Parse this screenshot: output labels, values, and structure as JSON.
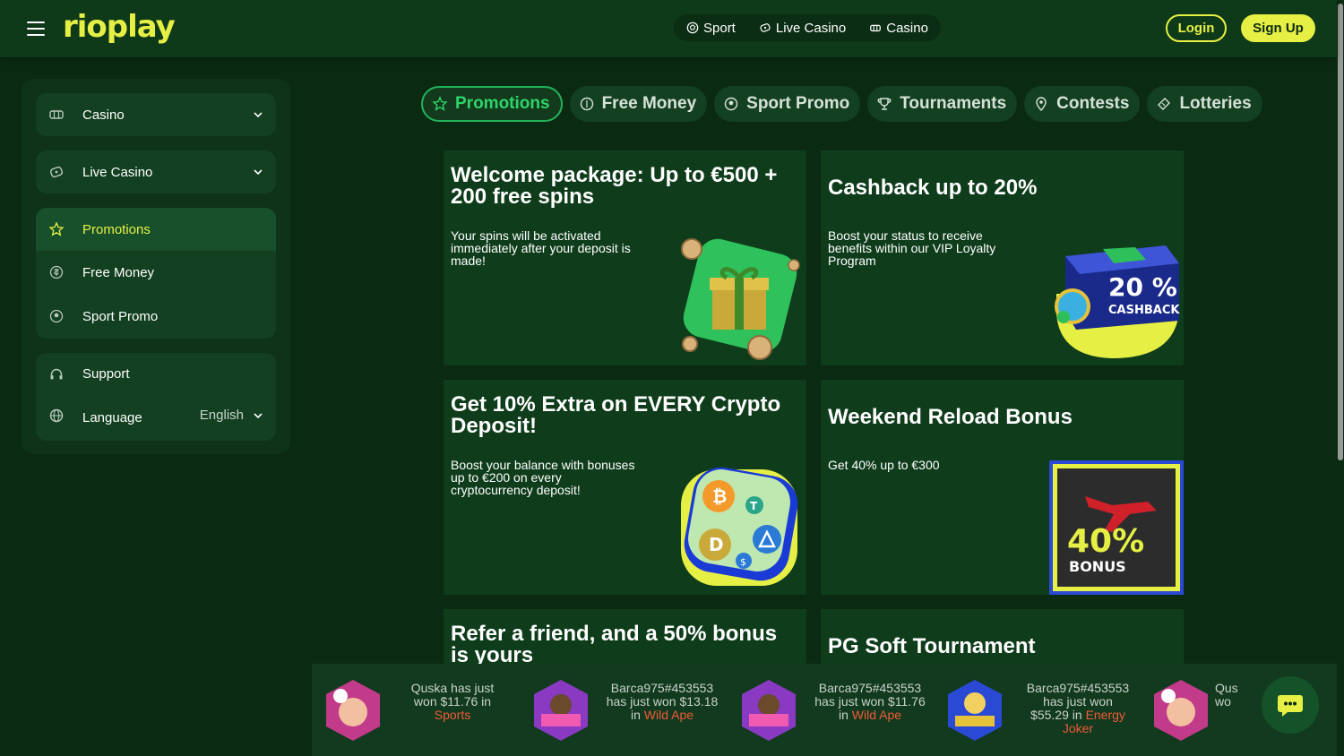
{
  "brand": {
    "logo_text": "rioplay",
    "accent": "#e6f044",
    "green": "#23b35a"
  },
  "header": {
    "nav": [
      {
        "label": "Sport",
        "icon": "football-icon"
      },
      {
        "label": "Live Casino",
        "icon": "live-casino-icon"
      },
      {
        "label": "Casino",
        "icon": "casino-icon"
      }
    ],
    "login_label": "Login",
    "signup_label": "Sign Up"
  },
  "sidebar": {
    "casino": "Casino",
    "live_casino": "Live Casino",
    "promotions": "Promotions",
    "free_money": "Free Money",
    "sport_promo": "Sport Promo",
    "support": "Support",
    "language": "Language",
    "language_value": "English"
  },
  "tabs": [
    {
      "label": "Promotions",
      "icon": "star-icon",
      "active": true
    },
    {
      "label": "Free Money",
      "icon": "money-icon",
      "active": false
    },
    {
      "label": "Sport Promo",
      "icon": "sport-promo-icon",
      "active": false
    },
    {
      "label": "Tournaments",
      "icon": "trophy-icon",
      "active": false
    },
    {
      "label": "Contests",
      "icon": "pin-icon",
      "active": false
    },
    {
      "label": "Lotteries",
      "icon": "ticket-icon",
      "active": false
    }
  ],
  "promos": [
    {
      "title": "Welcome package: Up to €500 + 200 free spins",
      "desc": "Your spins will be activated immediately after your deposit is made!"
    },
    {
      "title": "Cashback up to 20%",
      "desc": "Boost your status to receive benefits within our VIP Loyalty Program",
      "badge_pct": "20 %",
      "badge_word": "CASHBACK"
    },
    {
      "title": "Get 10% Extra on EVERY Crypto Deposit!",
      "desc": "Boost your balance with bonuses up to €200 on every cryptocurrency deposit!"
    },
    {
      "title": "Weekend Reload Bonus",
      "desc": "Get 40% up to €300",
      "badge_pct": "40%",
      "badge_word": "BONUS"
    },
    {
      "title": "Refer a friend, and a 50% bonus is yours"
    },
    {
      "title": "PG Soft Tournament"
    }
  ],
  "ticker": [
    {
      "line1": "Quska has just",
      "line2": "won $11.76 in",
      "game": "Sports"
    },
    {
      "line1": "Barca975#453553",
      "line2": "has just won $13.18",
      "line3": "in",
      "game": "Wild Ape"
    },
    {
      "line1": "Barca975#453553",
      "line2": "has just won $11.76",
      "line3": "in",
      "game": "Wild Ape"
    },
    {
      "line1": "Barca975#453553",
      "line2": "has just won",
      "line3": "$55.29 in",
      "game": "Energy Joker"
    },
    {
      "line1": "Qus",
      "line2": "wo"
    }
  ]
}
